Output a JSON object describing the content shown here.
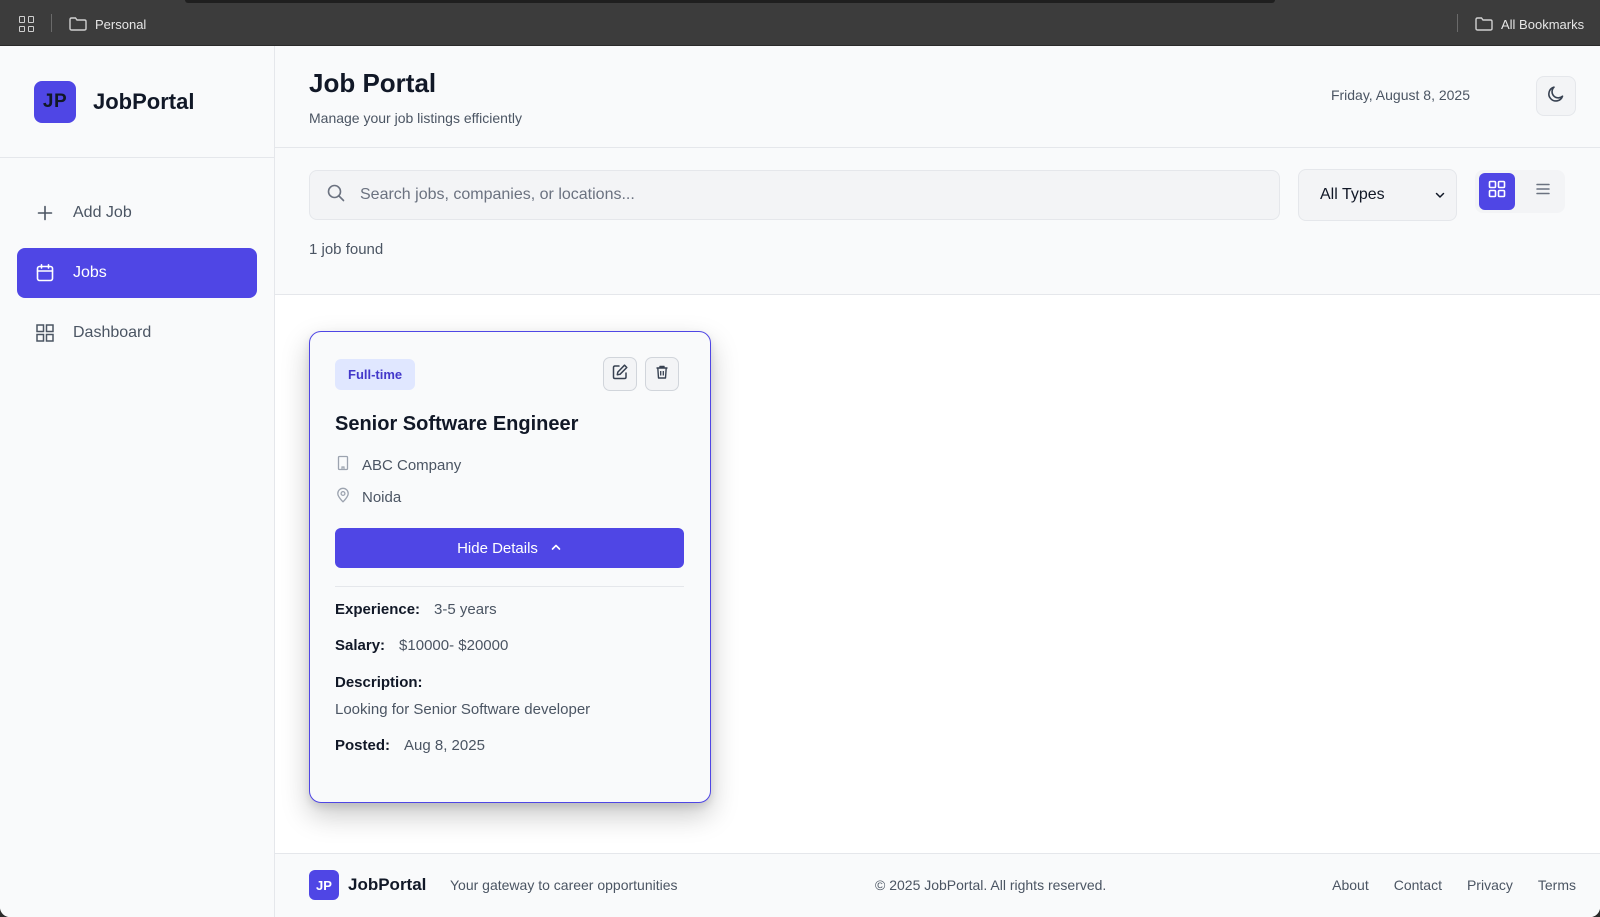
{
  "browser": {
    "bookmark_folder_left": "Personal",
    "bookmark_folder_right": "All Bookmarks"
  },
  "sidebar": {
    "logo_initials": "JP",
    "brand_name": "JobPortal",
    "items": [
      {
        "label": "Add Job",
        "icon": "plus-icon",
        "active": false
      },
      {
        "label": "Jobs",
        "icon": "calendar-icon",
        "active": true
      },
      {
        "label": "Dashboard",
        "icon": "grid-icon",
        "active": false
      }
    ]
  },
  "header": {
    "title": "Job Portal",
    "subtitle": "Manage your job listings efficiently",
    "date": "Friday, August 8, 2025",
    "theme_icon": "moon-icon"
  },
  "toolbar": {
    "search_placeholder": "Search jobs, companies, or locations...",
    "search_value": "",
    "type_filter": "All Types",
    "view_mode": "grid",
    "result_count": "1 job found"
  },
  "jobs": [
    {
      "type": "Full-time",
      "title": "Senior Software Engineer",
      "company": "ABC Company",
      "location": "Noida",
      "toggle_label": "Hide Details",
      "experience_label": "Experience:",
      "experience": "3-5 years",
      "salary_label": "Salary:",
      "salary": "$10000- $20000",
      "description_label": "Description:",
      "description": "Looking for Senior Software developer",
      "posted_label": "Posted:",
      "posted": "Aug 8, 2025"
    }
  ],
  "footer": {
    "logo_initials": "JP",
    "brand_name": "JobPortal",
    "tagline": "Your gateway to career opportunities",
    "copyright": "© 2025 JobPortal. All rights reserved.",
    "links": [
      "About",
      "Contact",
      "Privacy",
      "Terms"
    ]
  },
  "colors": {
    "accent": "#4f46e5",
    "badge_bg": "#e0e7ff",
    "badge_text": "#4338ca"
  }
}
